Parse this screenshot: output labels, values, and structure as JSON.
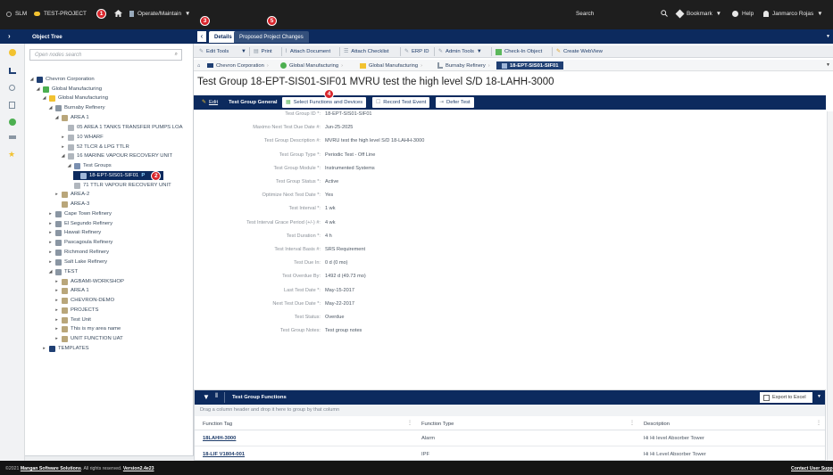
{
  "topbar": {
    "app": "SLM",
    "project": "TEST-PROJECT",
    "mode": "Operate/Maintain",
    "search_placeholder": "Search",
    "bookmark": "Bookmark",
    "help": "Help",
    "user": "Janmarco Rojas"
  },
  "sidebar": {
    "title": "Object Tree",
    "search_placeholder": "Open nodes search",
    "nodes": [
      "Chevron Corporation",
      "Global Manufacturing",
      "Global Manufacturing",
      "Burnaby Refinery",
      "AREA 1",
      "05 AREA 1 TANKS TRANSFER PUMPS LOA",
      "10 WHARF",
      "52 TLCR & LPG TTLR",
      "16 MARINE VAPOUR RECOVERY UNIT",
      "Test Groups",
      "18-EPT-SIS01-SIF01",
      "71 TTLR VAPOUR RECOVERY UNIT",
      "AREA-2",
      "AREA-3",
      "Cape Town Refinery",
      "El Segundo Refinery",
      "Hawaii Refinery",
      "Pascagoula Refinery",
      "Richmond Refinery",
      "Salt Lake Refinery",
      "TEST",
      "AGBAMI-WORKSHOP",
      "AREA 1",
      "CHEVRON-DEMO",
      "PROJECTS",
      "Test Unit",
      "This is my area name",
      "UNIT FUNCTION UAT",
      "TEMPLATES"
    ]
  },
  "tabs": {
    "details": "Details",
    "proposed": "Proposed Project Changes"
  },
  "badges": {
    "b1": "1",
    "b2": "2",
    "b3": "3",
    "b4": "4",
    "b5": "5"
  },
  "toolbar": {
    "edit_tools": "Edit Tools",
    "print": "Print",
    "attach_document": "Attach Document",
    "attach_checklist": "Attach Checklist",
    "erp_id": "ERP ID",
    "admin_tools": "Admin Tools",
    "check_in": "Check-In Object",
    "create_webview": "Create WebView"
  },
  "breadcrumb": [
    "Chevron Corporation",
    "Global Manufacturing",
    "Global Manufacturing",
    "Burnaby Refinery",
    "18-EPT-SIS01-SIF01"
  ],
  "page_title": "Test Group 18-EPT-SIS01-SIF01 MVRU test the high level S/D 18-LAHH-3000",
  "actions": {
    "edit": "Edit",
    "general": "Test Group General",
    "select_functions": "Select Functions and Devices",
    "record_test": "Record Test Event",
    "defer_test": "Defer Test"
  },
  "form": [
    {
      "label": "Test Group ID *:",
      "value": "18-EPT-SIS01-SIF01"
    },
    {
      "label": "Maximo Next Test Due Date #:",
      "value": "Jun-25-2025"
    },
    {
      "label": "Test Group Description #:",
      "value": "MVRU test the high level S/D 18-LAHH-3000"
    },
    {
      "label": "Test Group Type *:",
      "value": "Periodic Test - Off Line"
    },
    {
      "label": "Test Group Module *:",
      "value": "Instrumented Systems"
    },
    {
      "label": "Test Group Status *:",
      "value": "Active"
    },
    {
      "label": "Optimize Next Test Date *:",
      "value": "Yes"
    },
    {
      "label": "Test Interval *:",
      "value": "1 wk"
    },
    {
      "label": "Test Interval Grace Period (+/-) #:",
      "value": "4 wk"
    },
    {
      "label": "Test Duration *:",
      "value": "4 h"
    },
    {
      "label": "Test Interval Basis #:",
      "value": "SRS Requirement"
    },
    {
      "label": "Test Due In:",
      "value": "0 d (0 mo)"
    },
    {
      "label": "Test Overdue By:",
      "value": "1492 d (49.73 mo)"
    },
    {
      "label": "Last Test Date *:",
      "value": "May-15-2017"
    },
    {
      "label": "Next Test Due Date *:",
      "value": "May-22-2017"
    },
    {
      "label": "Test Status:",
      "value": "Overdue"
    },
    {
      "label": "Test Group Notes:",
      "value": "Test group notes"
    }
  ],
  "grid": {
    "title": "Test Group Functions",
    "export": "Export to Excel",
    "drag_hint": "Drag a column header and drop it here to group by that column",
    "columns": [
      "Function Tag",
      "Function Type",
      "Description"
    ],
    "rows": [
      [
        "18LAHH-3000",
        "Alarm",
        "Hi Hi level Absorber Tower"
      ],
      [
        "18-LIF V1804-001",
        "IPF",
        "Hi Hi Level Absorber Tower"
      ]
    ]
  },
  "footer": {
    "copyright": "©2021",
    "company": "Mangan Software Solutions",
    "rights": ". All rights reserved.",
    "version": "Version2.4e23",
    "contact": "Contact User Supp"
  },
  "colors": {
    "navy": "#0c2a5e",
    "badge": "#d9262c",
    "accent": "#f2c230"
  }
}
